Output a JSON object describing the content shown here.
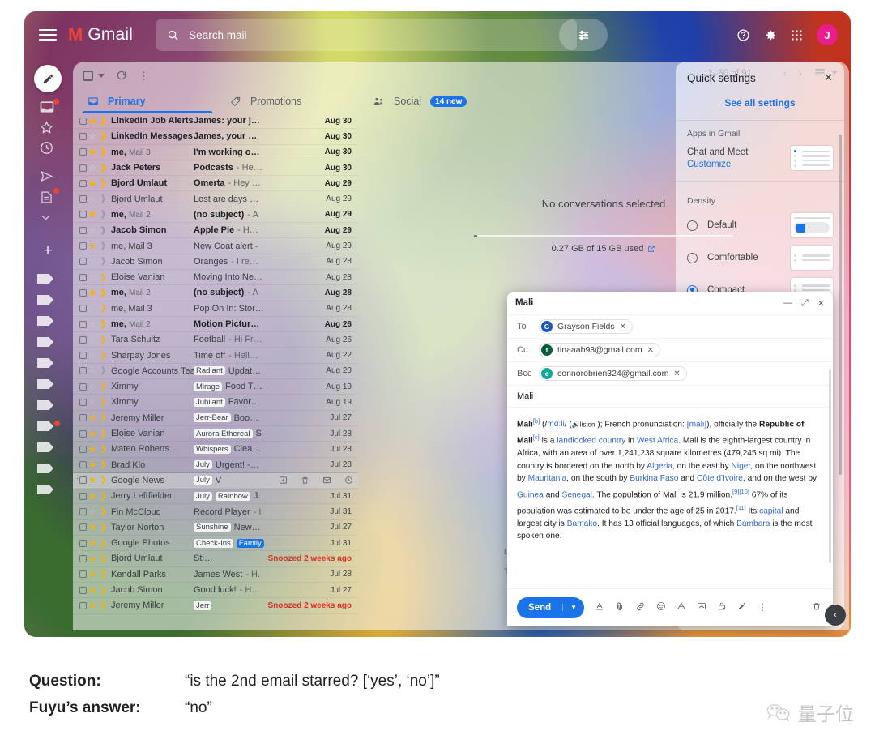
{
  "topbar": {
    "menu_icon": "hamburger-icon",
    "logo_mark": "M",
    "logo_word": "Gmail",
    "search_icon": "search-icon",
    "search_placeholder": "Search mail",
    "tune_icon": "tune-icon",
    "help_icon": "help-icon",
    "settings_icon": "gear-icon",
    "apps_icon": "apps-grid-icon",
    "avatar_initial": "J",
    "avatar_color": "#E91E8C"
  },
  "rail": {
    "compose_icon": "pencil-icon",
    "items": [
      "inbox-icon",
      "star-icon",
      "snoozed-clock-icon",
      "sent-icon",
      "drafts-icon",
      "chevron-down-icon",
      "add-icon"
    ],
    "label_count": 11
  },
  "toolbar": {
    "select_all_icon": "checkbox-icon",
    "select_caret_icon": "chevron-down-icon",
    "refresh_icon": "refresh-icon",
    "more_icon": "more-vertical-icon",
    "page_range": "1–50 of 91",
    "prev_icon": "chevron-left-icon",
    "next_icon": "chevron-right-icon",
    "split_icon": "split-pane-icon",
    "split_caret_icon": "chevron-down-icon"
  },
  "tabs": [
    {
      "label": "Primary",
      "icon": "inbox-tab-icon",
      "active": true,
      "badge": ""
    },
    {
      "label": "Promotions",
      "icon": "tag-icon",
      "active": false,
      "badge": ""
    },
    {
      "label": "Social",
      "icon": "people-icon",
      "active": false,
      "badge": "14 new"
    }
  ],
  "emails": [
    {
      "sender": "LinkedIn Job Alerts",
      "count": "",
      "subject": "James: your j…",
      "snippet": "",
      "label": "",
      "date": "Aug 30",
      "unread": true,
      "starred": true,
      "important": true
    },
    {
      "sender": "LinkedIn Messages",
      "count": "",
      "subject": "James, your …",
      "snippet": "",
      "label": "",
      "date": "Aug 30",
      "unread": true,
      "starred": false,
      "important": true
    },
    {
      "sender": "me,",
      "count": "Mail 3",
      "subject": "I'm working o…",
      "snippet": "",
      "label": "",
      "date": "Aug 30",
      "unread": true,
      "starred": true,
      "important": true
    },
    {
      "sender": "Jack Peters",
      "count": "",
      "subject": "Podcasts",
      "snippet": "- He…",
      "label": "",
      "date": "Aug 30",
      "unread": true,
      "starred": false,
      "important": true
    },
    {
      "sender": "Bjord Umlaut",
      "count": "",
      "subject": "Omerta",
      "snippet": "- Hey …",
      "label": "",
      "date": "Aug 29",
      "unread": true,
      "starred": true,
      "important": true
    },
    {
      "sender": "Bjord Umlaut",
      "count": "",
      "subject": "Lost are days …",
      "snippet": "",
      "label": "",
      "date": "Aug 29",
      "unread": false,
      "starred": false,
      "important": false
    },
    {
      "sender": "me,",
      "count": "Mail 2",
      "subject": "(no subject)",
      "snippet": "- A",
      "label": "",
      "date": "Aug 29",
      "unread": true,
      "starred": true,
      "important": false
    },
    {
      "sender": "Jacob Simon",
      "count": "",
      "subject": "Apple Pie",
      "snippet": "- H…",
      "label": "",
      "date": "Aug 29",
      "unread": true,
      "starred": false,
      "important": false
    },
    {
      "sender": "me, Mail 3",
      "count": "",
      "subject": "New Coat alert -",
      "snippet": "",
      "label": "",
      "date": "Aug 29",
      "unread": false,
      "starred": true,
      "important": false
    },
    {
      "sender": "Jacob Simon",
      "count": "",
      "subject": "Oranges",
      "snippet": "- I re…",
      "label": "",
      "date": "Aug 28",
      "unread": false,
      "starred": false,
      "important": false
    },
    {
      "sender": "Eloise Vanian",
      "count": "",
      "subject": "Moving Into Ne…",
      "snippet": "",
      "label": "",
      "date": "Aug 28",
      "unread": false,
      "starred": false,
      "important": true
    },
    {
      "sender": "me,",
      "count": "Mail 2",
      "subject": "(no subject)",
      "snippet": "- A",
      "label": "",
      "date": "Aug 28",
      "unread": true,
      "starred": true,
      "important": true
    },
    {
      "sender": "me, Mail 3",
      "count": "",
      "subject": "Pop On In: Stor…",
      "snippet": "",
      "label": "",
      "date": "Aug 28",
      "unread": false,
      "starred": false,
      "important": true
    },
    {
      "sender": "me,",
      "count": "Mail 2",
      "subject": "Motion Pictur…",
      "snippet": "",
      "label": "",
      "date": "Aug 26",
      "unread": true,
      "starred": false,
      "important": true
    },
    {
      "sender": "Tara Schultz",
      "count": "",
      "subject": "Football",
      "snippet": "- Hi Fr…",
      "label": "",
      "date": "Aug 26",
      "unread": false,
      "starred": false,
      "important": true
    },
    {
      "sender": "Sharpay Jones",
      "count": "",
      "subject": "Time off",
      "snippet": "- Hell…",
      "label": "",
      "date": "Aug 22",
      "unread": false,
      "starred": false,
      "important": true
    },
    {
      "sender": "Google Accounts Team",
      "count": "",
      "subject": "Updat…",
      "snippet": "",
      "label": "Radiant",
      "date": "Aug 20",
      "unread": false,
      "starred": false,
      "important": false
    },
    {
      "sender": "Ximmy",
      "count": "",
      "subject": "Food T…",
      "snippet": "",
      "label": "Mirage",
      "date": "Aug 19",
      "unread": false,
      "starred": false,
      "important": true
    },
    {
      "sender": "Ximmy",
      "count": "",
      "subject": "Favor…",
      "snippet": "",
      "label": "Jubilant",
      "date": "Aug 19",
      "unread": false,
      "starred": false,
      "important": true
    },
    {
      "sender": "Jeremy Miller",
      "count": "",
      "subject": "Boo…",
      "snippet": "",
      "label": "Jerr-Bear",
      "date": "Jul 27",
      "unread": false,
      "starred": true,
      "important": true
    },
    {
      "sender": "Eloise Vanian",
      "count": "",
      "subject": "S",
      "snippet": "",
      "label": "Aurora Ethereal",
      "date": "Jul 28",
      "unread": false,
      "starred": true,
      "important": true
    },
    {
      "sender": "Mateo Roberts",
      "count": "",
      "subject": "Clea…",
      "snippet": "",
      "label": "Whispers",
      "date": "Jul 28",
      "unread": false,
      "starred": true,
      "important": true
    },
    {
      "sender": "Brad Klo",
      "count": "",
      "subject": "Urgent! -…",
      "snippet": "",
      "label": "July",
      "date": "Jul 28",
      "unread": false,
      "starred": true,
      "important": true
    },
    {
      "sender": "Google News",
      "count": "",
      "subject": "V",
      "snippet": "",
      "label": "July",
      "date": "",
      "unread": false,
      "starred": true,
      "important": true,
      "hovered": true
    },
    {
      "sender": "Jerry Leftfielder",
      "count": "",
      "subject": "J.",
      "snippet": "",
      "label": "July",
      "label2": "Rainbow",
      "date": "Jul 31",
      "unread": false,
      "starred": true,
      "important": true
    },
    {
      "sender": "Fin McCloud",
      "count": "",
      "subject": "Record Player",
      "snippet": "- I",
      "label": "",
      "date": "Jul 31",
      "unread": false,
      "starred": false,
      "important": true
    },
    {
      "sender": "Taylor Norton",
      "count": "",
      "subject": "New…",
      "snippet": "",
      "label": "Sunshine",
      "date": "Jul 27",
      "unread": false,
      "starred": true,
      "important": true
    },
    {
      "sender": "Google Photos",
      "count": "",
      "subject": "",
      "snippet": "",
      "label": "Check-Ins",
      "label_blue": "Family",
      "date": "Jul 31",
      "unread": false,
      "starred": true,
      "important": true
    },
    {
      "sender": "Bjord Umlaut",
      "count": "",
      "subject": "Sti…",
      "snippet": "",
      "label": "",
      "date": "",
      "snoozed": "Snoozed 2 weeks ago",
      "unread": false,
      "starred": true,
      "important": true
    },
    {
      "sender": "Kendall Parks",
      "count": "",
      "subject": "James West",
      "snippet": "- H.",
      "label": "",
      "date": "Jul 28",
      "unread": false,
      "starred": true,
      "important": true
    },
    {
      "sender": "Jacob Simon",
      "count": "",
      "subject": "Good luck!",
      "snippet": "- H…",
      "label": "",
      "date": "Jul 27",
      "unread": false,
      "starred": true,
      "important": true
    },
    {
      "sender": "Jeremy Miller",
      "count": "",
      "subject": "",
      "snippet": "",
      "label": "Jerr",
      "date": "",
      "snoozed": "Snoozed 2 weeks ago",
      "unread": false,
      "starred": true,
      "important": true
    }
  ],
  "row_actions": [
    "archive-icon",
    "delete-icon",
    "mark-unread-icon",
    "snooze-icon"
  ],
  "readpane": {
    "empty_text": "No conversations selected",
    "storage_text": "0.27 GB of 15 GB used",
    "storage_link_icon": "open-external-icon",
    "footer_line1": "Last acc",
    "footer_line2": "Terms ·"
  },
  "quick_settings": {
    "title": "Quick settings",
    "close_icon": "close-icon",
    "see_all": "See all settings",
    "section_apps": "Apps in Gmail",
    "chat_and_meet": "Chat and Meet",
    "customize": "Customize",
    "section_density": "Density",
    "density_options": [
      {
        "label": "Default",
        "selected": false
      },
      {
        "label": "Comfortable",
        "selected": false
      },
      {
        "label": "Compact",
        "selected": true
      }
    ]
  },
  "compose": {
    "title": "Mali",
    "minimize_icon": "minimize-icon",
    "expand_icon": "expand-icon",
    "close_icon": "close-icon",
    "to_label": "To",
    "cc_label": "Cc",
    "bcc_label": "Bcc",
    "to_recipient": "Grayson Fields",
    "to_initial": "G",
    "to_color": "#1a56c4",
    "cc_recipient": "tinaaab93@gmail.com",
    "cc_initial": "t",
    "cc_color": "#0b5c3b",
    "bcc_recipient": "connorobrien324@gmail.com",
    "bcc_initial": "c",
    "bcc_color": "#14a79a",
    "remove_icon": "close-icon",
    "subject": "Mali",
    "body": {
      "p1_a": "Mali",
      "p1_sup_b": "[b]",
      "p1_b": " (/",
      "p1_ipa1": "mɑːli",
      "p1_c": "/ (",
      "p1_listen": "listen",
      "p1_d": " ); French pronunciation: ",
      "p1_ipa2": "[mali]",
      "p1_e": "), officially the ",
      "p1_bold": "Republic of Mali",
      "p1_sup_c": "[c]",
      "p1_f": " is a ",
      "p1_link1": "landlocked country",
      "p1_g": " in ",
      "p1_link2": "West Africa",
      "p1_h": ". Mali is the eighth-largest country in Africa, with an area of over 1,241,238 square kilometres (479,245 sq mi). The country is bordered on the north by ",
      "p1_link3": "Algeria",
      "p1_i": ", on the east by ",
      "p1_link4": "Niger",
      "p1_j": ", on the northwest by ",
      "p1_link5": "Mauritania",
      "p1_k": ", on the south by ",
      "p1_link6": "Burkina Faso",
      "p1_l": " and ",
      "p1_link7": "Côte d'Ivoire",
      "p1_m": ", and on the west by ",
      "p1_link8": "Guinea",
      "p1_n": " and ",
      "p1_link9": "Senegal",
      "p1_o": ". The population of Mali is 21.9 million.",
      "p1_sup_910": "[9][10]",
      "p1_p": " 67% of its population was estimated to be under the age of 25 in 2017.",
      "p1_sup_11": "[11]",
      "p1_q": " Its ",
      "p1_link10": "capital",
      "p1_r": " and largest city is ",
      "p1_link11": "Bamako",
      "p1_s": ". It has 13 official languages, of which ",
      "p1_link12": "Bambara",
      "p1_t": " is the most spoken one."
    },
    "send_label": "Send",
    "send_caret_icon": "chevron-down-icon",
    "toolbar_icons": [
      "format-text-icon",
      "attach-file-icon",
      "insert-link-icon",
      "insert-emoji-icon",
      "insert-drive-icon",
      "insert-photo-icon",
      "confidential-mode-icon",
      "signature-icon",
      "more-options-icon"
    ],
    "discard_icon": "trash-icon"
  },
  "chat_fab_icon": "chevron-left-icon",
  "caption": {
    "question_key": "Question:",
    "question_value": "“is the 2nd email starred? [‘yes’, ‘no’]”",
    "answer_key": "Fuyu’s answer:",
    "answer_value": "“no”"
  },
  "watermark": {
    "icon": "wechat-icon",
    "text": "量子位"
  }
}
